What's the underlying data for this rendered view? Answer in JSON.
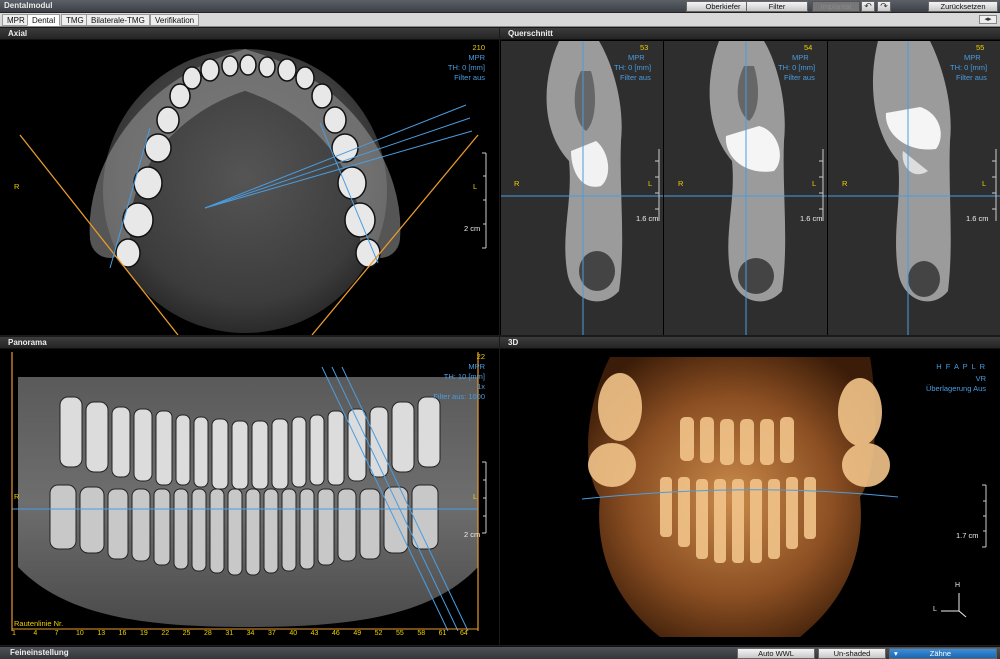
{
  "window": {
    "title": "Dentalmodul",
    "buttons": {
      "oberkiefer": "Oberkiefer",
      "filter": "Filter",
      "implantat": "Implantat",
      "zuruecksetzen": "Zurücksetzen"
    }
  },
  "tabs": [
    {
      "label": "MPR",
      "active": false
    },
    {
      "label": "Dental",
      "active": true
    },
    {
      "label": "TMG",
      "active": false
    },
    {
      "label": "Bilaterale-TMG",
      "active": false
    },
    {
      "label": "Verifikation",
      "active": false
    }
  ],
  "axial": {
    "title": "Axial",
    "slice": "210",
    "mode": "MPR",
    "th": "TH: 0 [mm]",
    "filter": "Filter aus",
    "left_marker": "R",
    "right_marker": "L",
    "scale": "2 cm"
  },
  "querschnitt": {
    "title": "Querschnitt",
    "slices": [
      {
        "num": "53",
        "mode": "MPR",
        "th": "TH: 0 [mm]",
        "filter": "Filter aus",
        "left": "R",
        "right": "L",
        "scale": "1.6 cm"
      },
      {
        "num": "54",
        "mode": "MPR",
        "th": "TH: 0 [mm]",
        "filter": "Filter aus",
        "left": "R",
        "right": "L",
        "scale": "1.6 cm"
      },
      {
        "num": "55",
        "mode": "MPR",
        "th": "TH: 0 [mm]",
        "filter": "Filter aus",
        "left": "R",
        "right": "L",
        "scale": "1.6 cm"
      }
    ]
  },
  "panorama": {
    "title": "Panorama",
    "slice": "22",
    "mode": "MPR",
    "th": "TH: 10 [mm]",
    "zoom": "1x",
    "filter": "Filter aus: 1000",
    "left_marker": "R",
    "right_marker": "L",
    "scale": "2 cm",
    "rautenlinie": "Rautenlinie Nr.",
    "ruler_ticks": [
      "1",
      "4",
      "7",
      "10",
      "13",
      "16",
      "19",
      "22",
      "25",
      "28",
      "31",
      "34",
      "37",
      "40",
      "43",
      "46",
      "49",
      "52",
      "55",
      "58",
      "61",
      "64"
    ]
  },
  "view3d": {
    "title": "3D",
    "orientation": "H F A P L R",
    "mode": "VR",
    "overlay": "Überlagerung Aus",
    "scale": "1.7 cm",
    "axis_h": "H",
    "axis_l": "L"
  },
  "statusbar": {
    "title": "Feineinstellung",
    "auto_wwl": "Auto WWL",
    "unshaded": "Un-shaded",
    "zaehne": "Zähne"
  },
  "colors": {
    "overlay_blue": "#4a9de0",
    "marker_yellow": "#f0d000",
    "guide_orange": "#e89a2e",
    "accent_blue": "#1d66b0"
  }
}
